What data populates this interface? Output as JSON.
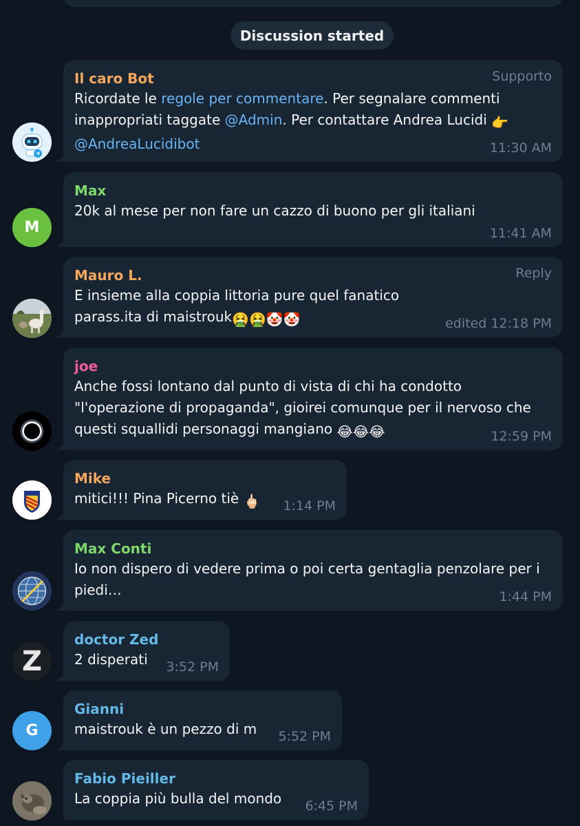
{
  "service": {
    "label": "Discussion started"
  },
  "colors": {
    "background": "#0e1621",
    "bubble": "#182533",
    "link": "#6ab3f3",
    "muted": "#6d7f8f"
  },
  "messages": [
    {
      "sender": "Il caro Bot",
      "sender_color": "#f4a65d",
      "badge": "Supporto",
      "text_parts": {
        "p1": "Ricordate le ",
        "link1": "regole per commentare",
        "p2": ". Per segnalare commenti inappropriati taggate ",
        "link2": "@Admin",
        "p3": ". Per contattare Andrea Lucidi ",
        "emoji": "👉",
        "link3": "@AndreaLucidibot"
      },
      "time": "11:30 AM",
      "avatar_icon": "robot-icon"
    },
    {
      "sender": "Max",
      "sender_color": "#7ed76b",
      "text": "20k al mese per non fare un cazzo di buono per gli italiani",
      "time": "11:41 AM",
      "avatar_letter": "M",
      "avatar_color": "#6ac13f"
    },
    {
      "sender": "Mauro L.",
      "sender_color": "#f4a65d",
      "badge": "Reply",
      "text": "E insieme alla coppia littoria pure quel fanatico parass.ita di maistrouk",
      "emojis": "🤮🤮🤡🤡",
      "time": "edited 12:18 PM",
      "avatar_icon": "alpaca-photo-icon"
    },
    {
      "sender": "joe",
      "sender_color": "#ee5c9c",
      "text": "Anche fossi lontano dal punto di vista di chi ha condotto \"l'operazione di propaganda\", gioirei comunque per il nervoso che questi squallidi personaggi mangiano",
      "emojis": "😂😂😂",
      "time": "12:59 PM",
      "avatar_icon": "eclipse-icon"
    },
    {
      "sender": "Mike",
      "sender_color": "#f4a65d",
      "text": "mitici!!! Pina Picerno tiè",
      "emojis": "🖕🏻",
      "time": "1:14 PM",
      "avatar_icon": "shield-crest-icon"
    },
    {
      "sender": "Max Conti",
      "sender_color": "#7ed76b",
      "text": "Io non dispero di vedere prima o poi certa gentaglia penzolare per i piedi…",
      "time": "1:44 PM",
      "avatar_icon": "globe-emblem-icon"
    },
    {
      "sender": "doctor Zed",
      "sender_color": "#64b9e6",
      "text": "2 disperati",
      "time": "3:52 PM",
      "avatar_letter": "Z"
    },
    {
      "sender": "Gianni",
      "sender_color": "#64b9e6",
      "text": "maistrouk è un pezzo di m",
      "time": "5:52 PM",
      "avatar_letter": "G",
      "avatar_color": "#3fa2e8"
    },
    {
      "sender": "Fabio Pieiller",
      "sender_color": "#64b9e6",
      "text": "La coppia più bulla del mondo",
      "time": "6:45 PM",
      "avatar_icon": "animal-photo-icon"
    }
  ]
}
